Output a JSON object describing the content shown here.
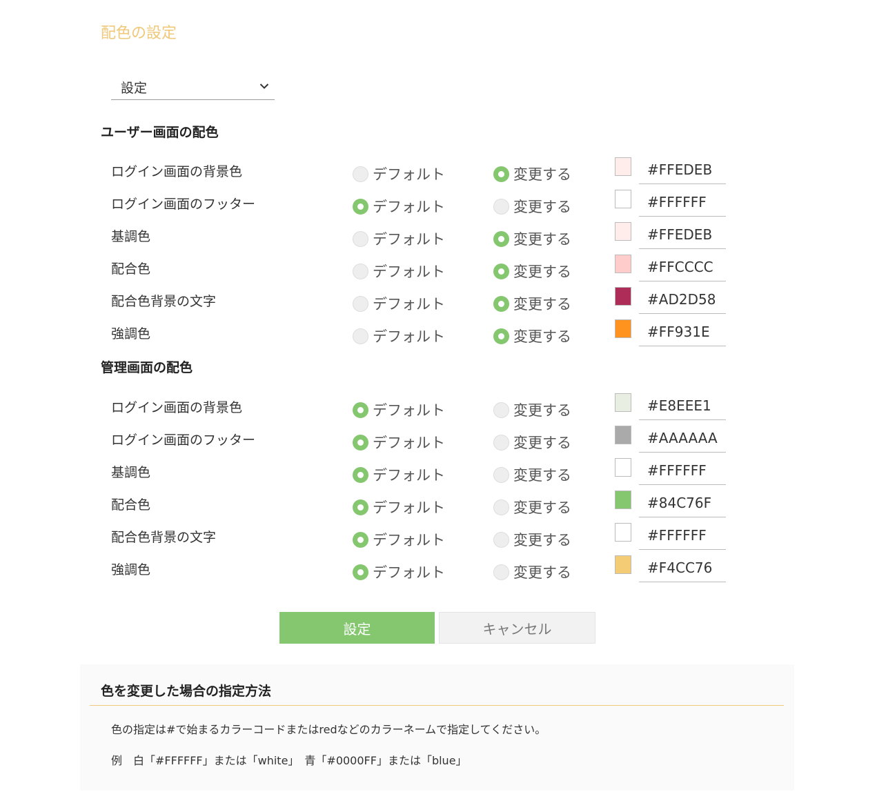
{
  "page": {
    "title": "配色の設定"
  },
  "select": {
    "value": "設定"
  },
  "user_section": {
    "title": "ユーザー画面の配色",
    "rows": [
      {
        "label": "ログイン画面の背景色",
        "default_label": "デフォルト",
        "change_label": "変更する",
        "selected": "change",
        "color": "#FFEDEB"
      },
      {
        "label": "ログイン画面のフッター",
        "default_label": "デフォルト",
        "change_label": "変更する",
        "selected": "default",
        "color": "#FFFFFF"
      },
      {
        "label": "基調色",
        "default_label": "デフォルト",
        "change_label": "変更する",
        "selected": "change",
        "color": "#FFEDEB"
      },
      {
        "label": "配合色",
        "default_label": "デフォルト",
        "change_label": "変更する",
        "selected": "change",
        "color": "#FFCCCC"
      },
      {
        "label": "配合色背景の文字",
        "default_label": "デフォルト",
        "change_label": "変更する",
        "selected": "change",
        "color": "#AD2D58"
      },
      {
        "label": "強調色",
        "default_label": "デフォルト",
        "change_label": "変更する",
        "selected": "change",
        "color": "#FF931E"
      }
    ]
  },
  "admin_section": {
    "title": "管理画面の配色",
    "rows": [
      {
        "label": "ログイン画面の背景色",
        "default_label": "デフォルト",
        "change_label": "変更する",
        "selected": "default",
        "color": "#E8EEE1"
      },
      {
        "label": "ログイン画面のフッター",
        "default_label": "デフォルト",
        "change_label": "変更する",
        "selected": "default",
        "color": "#AAAAAA"
      },
      {
        "label": "基調色",
        "default_label": "デフォルト",
        "change_label": "変更する",
        "selected": "default",
        "color": "#FFFFFF"
      },
      {
        "label": "配合色",
        "default_label": "デフォルト",
        "change_label": "変更する",
        "selected": "default",
        "color": "#84C76F"
      },
      {
        "label": "配合色背景の文字",
        "default_label": "デフォルト",
        "change_label": "変更する",
        "selected": "default",
        "color": "#FFFFFF"
      },
      {
        "label": "強調色",
        "default_label": "デフォルト",
        "change_label": "変更する",
        "selected": "default",
        "color": "#F4CC76"
      }
    ]
  },
  "buttons": {
    "submit_label": "設定",
    "cancel_label": "キャンセル"
  },
  "help": {
    "title": "色を変更した場合の指定方法",
    "line1": "色の指定は#で始まるカラーコードまたはredなどのカラーネームで指定してください。",
    "line2": "例　白「#FFFFFF」または「white」　青「#0000FF」または「blue」"
  },
  "theme": {
    "accent": "#84C76F",
    "title_color": "#F0C87A"
  }
}
